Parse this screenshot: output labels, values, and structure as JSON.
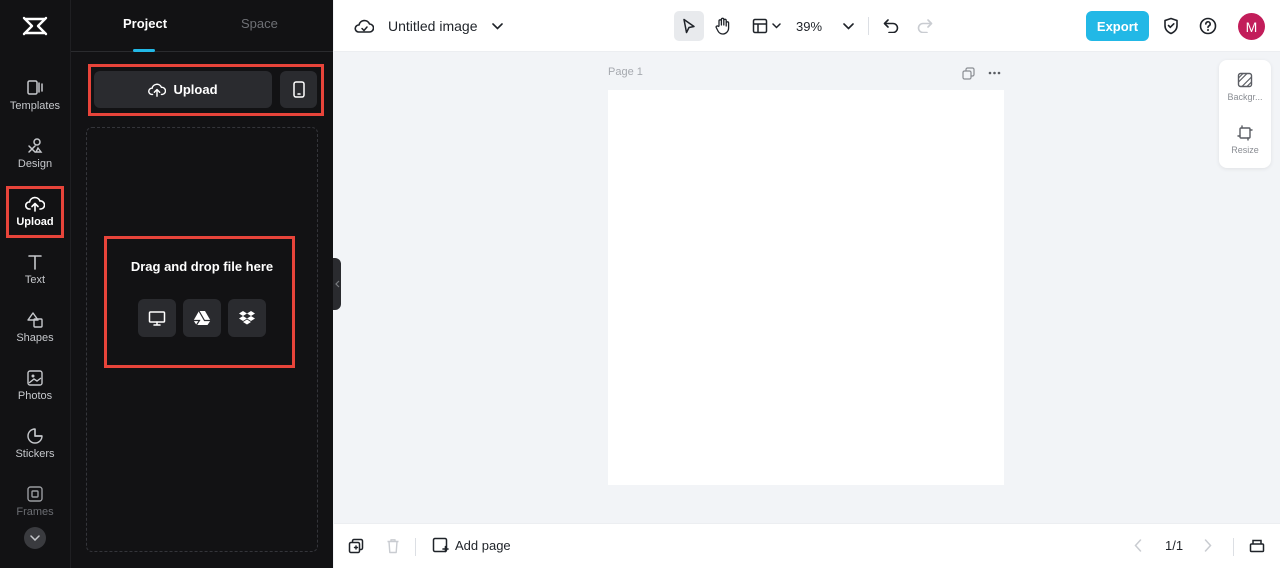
{
  "rail": {
    "items": [
      {
        "label": "Templates"
      },
      {
        "label": "Design"
      },
      {
        "label": "Upload"
      },
      {
        "label": "Text"
      },
      {
        "label": "Shapes"
      },
      {
        "label": "Photos"
      },
      {
        "label": "Stickers"
      },
      {
        "label": "Frames"
      }
    ],
    "active": "Upload"
  },
  "panel": {
    "tabs": [
      {
        "label": "Project"
      },
      {
        "label": "Space"
      }
    ],
    "active_tab": "Project",
    "upload_label": "Upload",
    "drop_title": "Drag and drop file here"
  },
  "topbar": {
    "title": "Untitled image",
    "zoom": "39%",
    "export_label": "Export",
    "avatar_initial": "M"
  },
  "canvas": {
    "page_label": "Page 1"
  },
  "side_tools": [
    {
      "label": "Backgr..."
    },
    {
      "label": "Resize"
    }
  ],
  "bottombar": {
    "add_page_label": "Add page",
    "page_indicator": "1/1"
  },
  "colors": {
    "accent": "#22b8e6",
    "highlight": "#e8443a",
    "avatar": "#c21d5a",
    "sidebar_bg": "#121214"
  }
}
